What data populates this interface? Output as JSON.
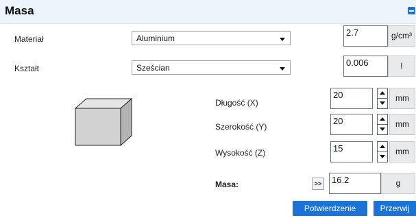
{
  "header": {
    "title": "Masa",
    "icon": "save-icon"
  },
  "material": {
    "label": "Materiał",
    "value": "Aluminium",
    "density": "2.7",
    "density_unit": "g/cm³"
  },
  "shape": {
    "label": "Kształt",
    "value": "Sześcian",
    "volume": "0.006",
    "volume_unit": "l"
  },
  "dimensions": [
    {
      "label": "Długość (X)",
      "value": "20",
      "unit": "mm"
    },
    {
      "label": "Szerokość (Y)",
      "value": "20",
      "unit": "mm"
    },
    {
      "label": "Wysokość (Z)",
      "value": "15",
      "unit": "mm"
    }
  ],
  "mass": {
    "label": "Masa:",
    "calc_label": ">>",
    "value": "16.2",
    "unit": "g"
  },
  "buttons": {
    "confirm": "Potwierdzenie",
    "cancel": "Przerwij"
  },
  "colors": {
    "accent": "#1a73d9",
    "header_bg": "#eef4fb"
  }
}
